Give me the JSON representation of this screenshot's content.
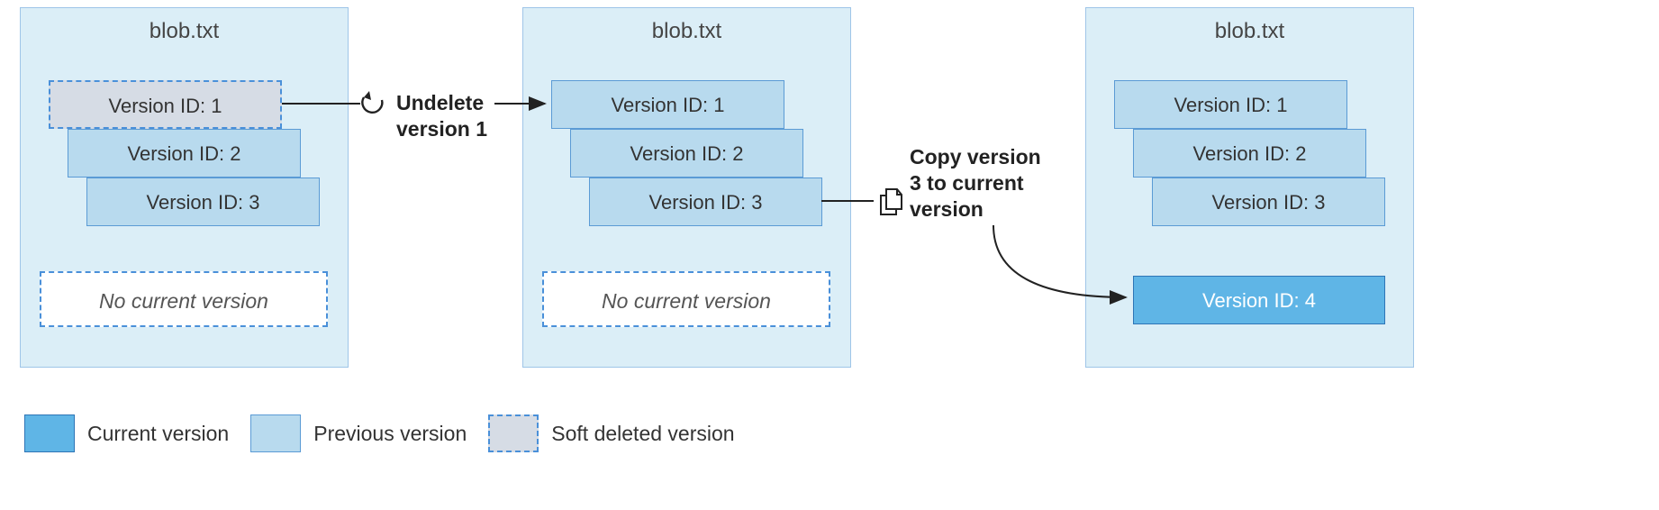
{
  "panels": {
    "p1": {
      "title": "blob.txt",
      "v1": "Version ID: 1",
      "v2": "Version ID: 2",
      "v3": "Version ID: 3",
      "no_current": "No current version"
    },
    "p2": {
      "title": "blob.txt",
      "v1": "Version ID: 1",
      "v2": "Version ID: 2",
      "v3": "Version ID: 3",
      "no_current": "No current version"
    },
    "p3": {
      "title": "blob.txt",
      "v1": "Version ID: 1",
      "v2": "Version ID: 2",
      "v3": "Version ID: 3",
      "v4": "Version ID: 4"
    }
  },
  "actions": {
    "undelete1": "Undelete version 1",
    "undelete1_line1": "Undelete",
    "undelete1_line2": "version 1",
    "copy3": "Copy version 3 to current version",
    "copy3_line1": "Copy version",
    "copy3_line2": "3 to current",
    "copy3_line3": "version"
  },
  "legend": {
    "current": "Current version",
    "previous": "Previous version",
    "soft": "Soft deleted version"
  }
}
